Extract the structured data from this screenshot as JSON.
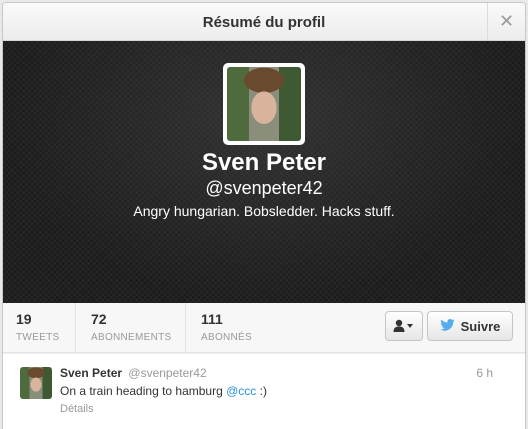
{
  "modal": {
    "title": "Résumé du profil",
    "close_icon": "close-icon"
  },
  "profile": {
    "name": "Sven Peter",
    "handle": "@svenpeter42",
    "bio": "Angry hungarian. Bobsledder. Hacks stuff."
  },
  "stats": [
    {
      "value": "19",
      "label": "TWEETS"
    },
    {
      "value": "72",
      "label": "ABONNEMENTS"
    },
    {
      "value": "111",
      "label": "ABONNÉS"
    }
  ],
  "actions": {
    "user_menu_icon": "user-dropdown-icon",
    "follow_label": "Suivre",
    "follow_icon": "twitter-bird-icon"
  },
  "tweet": {
    "author_name": "Sven Peter",
    "author_handle": "@svenpeter42",
    "time": "6 h",
    "text_before": "On a train heading to hamburg ",
    "mention": "@ccc",
    "text_after": " :)",
    "details_label": "Détails"
  },
  "colors": {
    "accent": "#55acee",
    "mention": "#2a8fd6",
    "banner": "#1c1c1c"
  }
}
